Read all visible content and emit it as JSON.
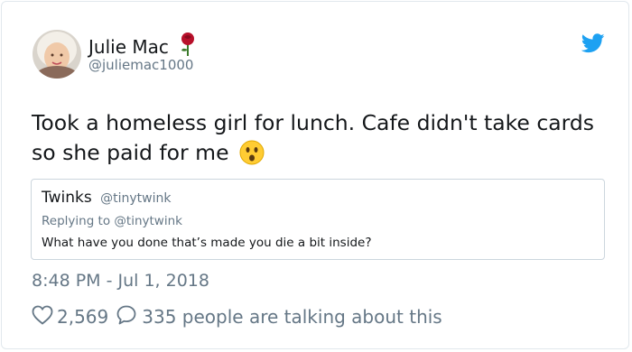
{
  "tweet": {
    "author": {
      "display_name": "Julie Mac",
      "handle": "@juliemac1000",
      "badge_icon": "rose-icon",
      "avatar": "avatar-photo"
    },
    "platform_icon": "twitter-bird-icon",
    "text": "Took a homeless girl for lunch. Cafe didn't take cards so she paid for me",
    "text_emoji": "astonished-face-icon",
    "quoted": {
      "display_name": "Twinks",
      "handle": "@tinytwink",
      "replying_to": "Replying to @tinytwink",
      "text": "What have you done that’s made you die a bit inside?"
    },
    "timestamp": "8:48 PM - Jul 1, 2018",
    "actions": {
      "like_icon": "heart-icon",
      "like_count": "2,569",
      "talk_icon": "speech-bubble-icon",
      "talk_text": "335 people are talking about this"
    }
  },
  "colors": {
    "text": "#14171a",
    "secondary": "#657786",
    "brand": "#1da1f2",
    "border": "#e1e8ed"
  }
}
